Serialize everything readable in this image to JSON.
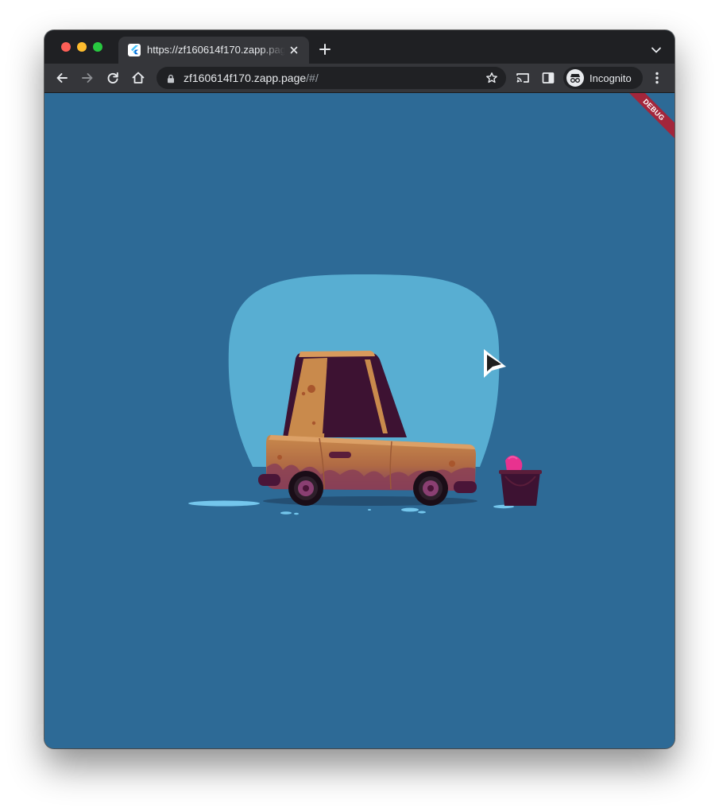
{
  "browser": {
    "tab": {
      "title": "https://zf160614f170.zapp.page/#/",
      "favicon": "flutter-icon"
    },
    "address_bar": {
      "host": "zf160614f170.zapp.page",
      "path": "/#/"
    },
    "profile": {
      "label": "Incognito",
      "icon": "incognito-icon"
    },
    "icons": {
      "back": "arrow-left-icon",
      "forward": "arrow-right-icon",
      "reload": "reload-icon",
      "home": "home-icon",
      "secure": "lock-icon",
      "bookmark": "star-icon",
      "cast": "cast-icon",
      "side_panel": "side-panel-icon",
      "menu": "kebab-menu-icon",
      "new_tab": "plus-icon",
      "tab_search": "chevron-down-icon",
      "close_tab": "close-icon"
    }
  },
  "app": {
    "debug_banner": "DEBUG",
    "illustration": "car-wash-illustration",
    "colors": {
      "background": "#2d6a96",
      "backdrop": "#58aed2",
      "car_body": "#c98a4c",
      "car_dark": "#3d1232",
      "sponge": "#e8328f"
    }
  }
}
